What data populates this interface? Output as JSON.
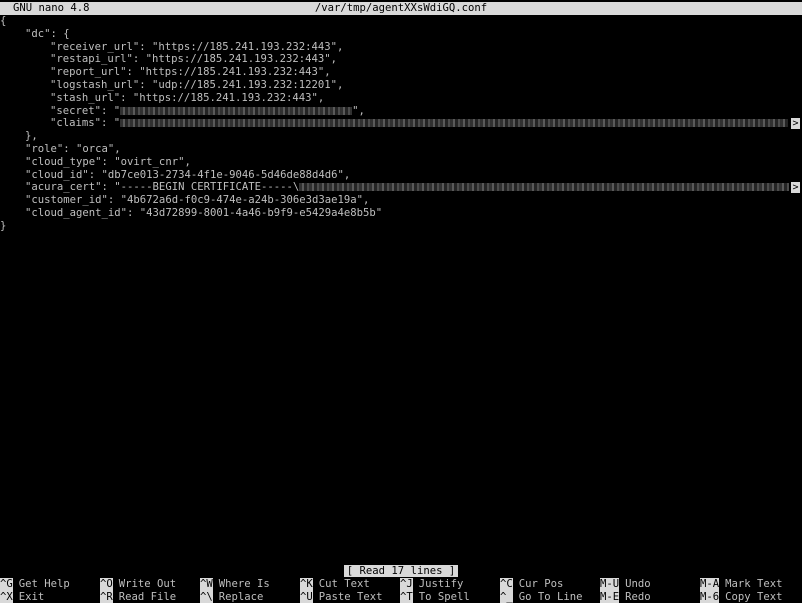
{
  "app": "GNU nano 4.8",
  "filename": "/var/tmp/agentXXsWdiGQ.conf",
  "lines": [
    {
      "indent": 0,
      "text": "{"
    },
    {
      "indent": 1,
      "text": "\"dc\": {"
    },
    {
      "indent": 2,
      "text": "\"receiver_url\": \"https://185.241.193.232:443\","
    },
    {
      "indent": 2,
      "text": "\"restapi_url\": \"https://185.241.193.232:443\","
    },
    {
      "indent": 2,
      "text": "\"report_url\": \"https://185.241.193.232:443\","
    },
    {
      "indent": 2,
      "text": "\"logstash_url\": \"udp://185.241.193.232:12201\","
    },
    {
      "indent": 2,
      "text": "\"stash_url\": \"https://185.241.193.232:443\","
    },
    {
      "indent": 2,
      "text": "\"secret\": \"",
      "after": "\","
    },
    {
      "indent": 2,
      "text": "\"claims\": \""
    },
    {
      "indent": 1,
      "text": "},"
    },
    {
      "indent": 1,
      "text": "\"role\": \"orca\","
    },
    {
      "indent": 1,
      "text": "\"cloud_type\": \"ovirt_cnr\","
    },
    {
      "indent": 1,
      "text": "\"cloud_id\": \"db7ce013-2734-4f1e-9046-5d46de88d4d6\","
    },
    {
      "indent": 1,
      "text": "\"acura_cert\": \"-----BEGIN CERTIFICATE-----\\"
    },
    {
      "indent": 1,
      "text": "\"customer_id\": \"4b672a6d-f0c9-474e-a24b-306e3d3ae19a\","
    },
    {
      "indent": 1,
      "text": "\"cloud_agent_id\": \"43d72899-8001-4a46-b9f9-e5429a4e8b5b\""
    },
    {
      "indent": 0,
      "text": "}"
    }
  ],
  "overflow_marker": ">",
  "status_message": "[ Read 17 lines ]",
  "shortcuts_row1": [
    {
      "key": "^G",
      "label": "Get Help"
    },
    {
      "key": "^O",
      "label": "Write Out"
    },
    {
      "key": "^W",
      "label": "Where Is"
    },
    {
      "key": "^K",
      "label": "Cut Text"
    },
    {
      "key": "^J",
      "label": "Justify"
    },
    {
      "key": "^C",
      "label": "Cur Pos"
    },
    {
      "key": "M-U",
      "label": "Undo"
    },
    {
      "key": "M-A",
      "label": "Mark Text"
    }
  ],
  "shortcuts_row2": [
    {
      "key": "^X",
      "label": "Exit"
    },
    {
      "key": "^R",
      "label": "Read File"
    },
    {
      "key": "^\\",
      "label": "Replace"
    },
    {
      "key": "^U",
      "label": "Paste Text"
    },
    {
      "key": "^T",
      "label": "To Spell"
    },
    {
      "key": "^_",
      "label": "Go To Line"
    },
    {
      "key": "M-E",
      "label": "Redo"
    },
    {
      "key": "M-6",
      "label": "Copy Text"
    }
  ]
}
